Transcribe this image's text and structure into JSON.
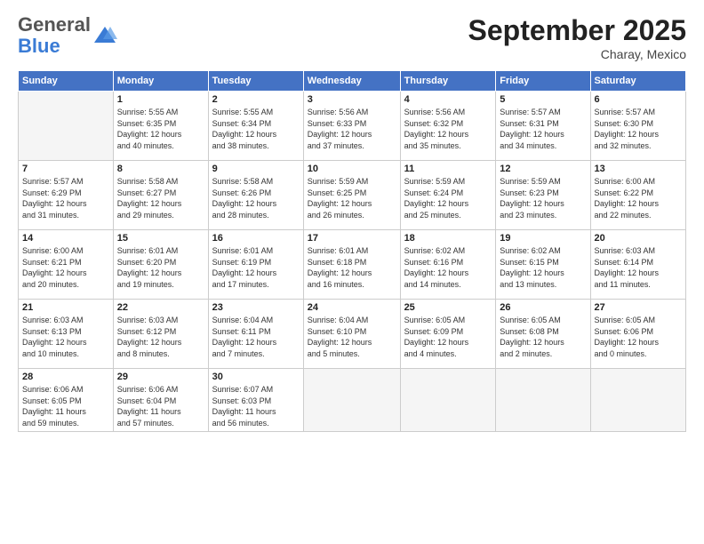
{
  "header": {
    "logo": {
      "line1": "General",
      "line2": "Blue"
    },
    "title": "September 2025",
    "subtitle": "Charay, Mexico"
  },
  "days_of_week": [
    "Sunday",
    "Monday",
    "Tuesday",
    "Wednesday",
    "Thursday",
    "Friday",
    "Saturday"
  ],
  "weeks": [
    [
      {
        "num": "",
        "info": ""
      },
      {
        "num": "1",
        "info": "Sunrise: 5:55 AM\nSunset: 6:35 PM\nDaylight: 12 hours\nand 40 minutes."
      },
      {
        "num": "2",
        "info": "Sunrise: 5:55 AM\nSunset: 6:34 PM\nDaylight: 12 hours\nand 38 minutes."
      },
      {
        "num": "3",
        "info": "Sunrise: 5:56 AM\nSunset: 6:33 PM\nDaylight: 12 hours\nand 37 minutes."
      },
      {
        "num": "4",
        "info": "Sunrise: 5:56 AM\nSunset: 6:32 PM\nDaylight: 12 hours\nand 35 minutes."
      },
      {
        "num": "5",
        "info": "Sunrise: 5:57 AM\nSunset: 6:31 PM\nDaylight: 12 hours\nand 34 minutes."
      },
      {
        "num": "6",
        "info": "Sunrise: 5:57 AM\nSunset: 6:30 PM\nDaylight: 12 hours\nand 32 minutes."
      }
    ],
    [
      {
        "num": "7",
        "info": "Sunrise: 5:57 AM\nSunset: 6:29 PM\nDaylight: 12 hours\nand 31 minutes."
      },
      {
        "num": "8",
        "info": "Sunrise: 5:58 AM\nSunset: 6:27 PM\nDaylight: 12 hours\nand 29 minutes."
      },
      {
        "num": "9",
        "info": "Sunrise: 5:58 AM\nSunset: 6:26 PM\nDaylight: 12 hours\nand 28 minutes."
      },
      {
        "num": "10",
        "info": "Sunrise: 5:59 AM\nSunset: 6:25 PM\nDaylight: 12 hours\nand 26 minutes."
      },
      {
        "num": "11",
        "info": "Sunrise: 5:59 AM\nSunset: 6:24 PM\nDaylight: 12 hours\nand 25 minutes."
      },
      {
        "num": "12",
        "info": "Sunrise: 5:59 AM\nSunset: 6:23 PM\nDaylight: 12 hours\nand 23 minutes."
      },
      {
        "num": "13",
        "info": "Sunrise: 6:00 AM\nSunset: 6:22 PM\nDaylight: 12 hours\nand 22 minutes."
      }
    ],
    [
      {
        "num": "14",
        "info": "Sunrise: 6:00 AM\nSunset: 6:21 PM\nDaylight: 12 hours\nand 20 minutes."
      },
      {
        "num": "15",
        "info": "Sunrise: 6:01 AM\nSunset: 6:20 PM\nDaylight: 12 hours\nand 19 minutes."
      },
      {
        "num": "16",
        "info": "Sunrise: 6:01 AM\nSunset: 6:19 PM\nDaylight: 12 hours\nand 17 minutes."
      },
      {
        "num": "17",
        "info": "Sunrise: 6:01 AM\nSunset: 6:18 PM\nDaylight: 12 hours\nand 16 minutes."
      },
      {
        "num": "18",
        "info": "Sunrise: 6:02 AM\nSunset: 6:16 PM\nDaylight: 12 hours\nand 14 minutes."
      },
      {
        "num": "19",
        "info": "Sunrise: 6:02 AM\nSunset: 6:15 PM\nDaylight: 12 hours\nand 13 minutes."
      },
      {
        "num": "20",
        "info": "Sunrise: 6:03 AM\nSunset: 6:14 PM\nDaylight: 12 hours\nand 11 minutes."
      }
    ],
    [
      {
        "num": "21",
        "info": "Sunrise: 6:03 AM\nSunset: 6:13 PM\nDaylight: 12 hours\nand 10 minutes."
      },
      {
        "num": "22",
        "info": "Sunrise: 6:03 AM\nSunset: 6:12 PM\nDaylight: 12 hours\nand 8 minutes."
      },
      {
        "num": "23",
        "info": "Sunrise: 6:04 AM\nSunset: 6:11 PM\nDaylight: 12 hours\nand 7 minutes."
      },
      {
        "num": "24",
        "info": "Sunrise: 6:04 AM\nSunset: 6:10 PM\nDaylight: 12 hours\nand 5 minutes."
      },
      {
        "num": "25",
        "info": "Sunrise: 6:05 AM\nSunset: 6:09 PM\nDaylight: 12 hours\nand 4 minutes."
      },
      {
        "num": "26",
        "info": "Sunrise: 6:05 AM\nSunset: 6:08 PM\nDaylight: 12 hours\nand 2 minutes."
      },
      {
        "num": "27",
        "info": "Sunrise: 6:05 AM\nSunset: 6:06 PM\nDaylight: 12 hours\nand 0 minutes."
      }
    ],
    [
      {
        "num": "28",
        "info": "Sunrise: 6:06 AM\nSunset: 6:05 PM\nDaylight: 11 hours\nand 59 minutes."
      },
      {
        "num": "29",
        "info": "Sunrise: 6:06 AM\nSunset: 6:04 PM\nDaylight: 11 hours\nand 57 minutes."
      },
      {
        "num": "30",
        "info": "Sunrise: 6:07 AM\nSunset: 6:03 PM\nDaylight: 11 hours\nand 56 minutes."
      },
      {
        "num": "",
        "info": ""
      },
      {
        "num": "",
        "info": ""
      },
      {
        "num": "",
        "info": ""
      },
      {
        "num": "",
        "info": ""
      }
    ]
  ]
}
